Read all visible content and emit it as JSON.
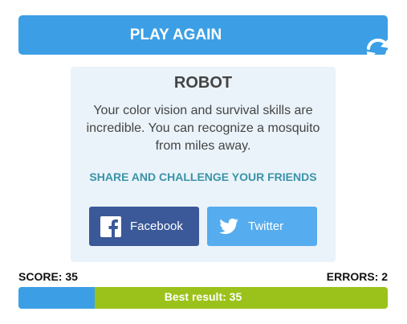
{
  "play_again": {
    "label": "PLAY AGAIN",
    "icon": "refresh-icon"
  },
  "result": {
    "title": "ROBOT",
    "description": "Your color vision and survival skills are incredible. You can recognize a mosquito from miles away.",
    "share_heading": "SHARE AND CHALLENGE YOUR FRIENDS",
    "buttons": [
      {
        "label": "Facebook",
        "icon": "facebook-icon",
        "color": "#3b5998"
      },
      {
        "label": "Twitter",
        "icon": "twitter-icon",
        "color": "#55acee"
      }
    ]
  },
  "stats": {
    "score_label": "SCORE: 35",
    "errors_label": "ERRORS: 2",
    "best_result": "Best result: 35"
  },
  "colors": {
    "accent_blue": "#3c9fe5",
    "progress_green": "#9bc21a",
    "card_background": "#eaf3fa",
    "share_heading": "#3a93a8"
  }
}
